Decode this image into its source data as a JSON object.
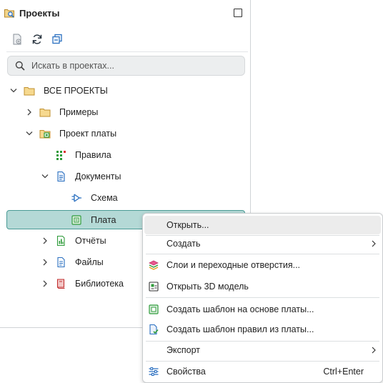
{
  "panel": {
    "title": "Проекты",
    "search_placeholder": "Искать в проектах..."
  },
  "tree": {
    "root": "ВСЕ ПРОЕКТЫ",
    "examples": "Примеры",
    "board_project": "Проект платы",
    "rules": "Правила",
    "documents": "Документы",
    "schematic": "Схема",
    "board": "Плата",
    "reports": "Отчёты",
    "files": "Файлы",
    "library": "Библиотека"
  },
  "context_menu": {
    "open": "Открыть...",
    "create": "Создать",
    "layers": "Слои и переходные отверстия...",
    "open3d": "Открыть 3D модель",
    "template_board": "Создать шаблон на основе платы...",
    "template_rules": "Создать шаблон правил из платы...",
    "export": "Экспорт",
    "properties": "Свойства",
    "properties_shortcut": "Ctrl+Enter"
  },
  "colors": {
    "selected_bg": "#b4d9d6",
    "selected_border": "#4a9a95",
    "folder": "#e7b85b",
    "accent_green": "#2e9b3a"
  },
  "icons": [
    "projects-search-icon",
    "new-project-icon",
    "refresh-icon",
    "collapse-all-icon",
    "search-icon",
    "folder-icon",
    "rules-icon",
    "document-icon",
    "schematic-icon",
    "board-icon",
    "report-icon",
    "file-icon",
    "library-icon",
    "layers-icon",
    "3d-model-icon",
    "template-icon",
    "properties-icon"
  ]
}
